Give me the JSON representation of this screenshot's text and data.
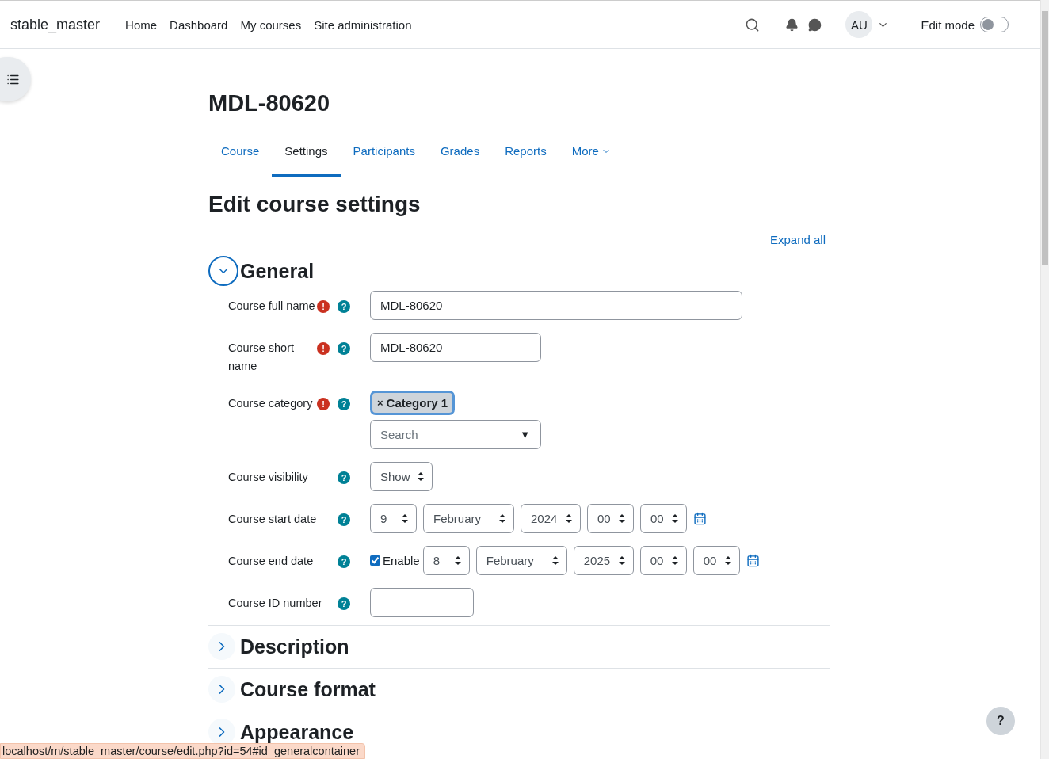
{
  "site_name": "stable_master",
  "nav": [
    "Home",
    "Dashboard",
    "My courses",
    "Site administration"
  ],
  "user_initials": "AU",
  "edit_mode": {
    "label": "Edit mode",
    "on": false
  },
  "course_title": "MDL-80620",
  "tabs": [
    {
      "label": "Course",
      "selected": false,
      "kind": "link"
    },
    {
      "label": "Settings",
      "selected": true,
      "kind": "link"
    },
    {
      "label": "Participants",
      "selected": false,
      "kind": "link"
    },
    {
      "label": "Grades",
      "selected": false,
      "kind": "link"
    },
    {
      "label": "Reports",
      "selected": false,
      "kind": "link"
    },
    {
      "label": "More",
      "selected": false,
      "kind": "dropdown"
    }
  ],
  "page_title": "Edit course settings",
  "expand_all": "Expand all",
  "sections": [
    {
      "title": "General",
      "expanded": true,
      "fields": [
        {
          "kind": "text",
          "label": "Course full name",
          "required": true,
          "value": "MDL-80620"
        },
        {
          "kind": "text",
          "label": "Course short name",
          "required": true,
          "value": "MDL-80620"
        },
        {
          "kind": "autocomplete",
          "label": "Course category",
          "required": true,
          "chips": [
            {
              "remove": "×",
              "label": "Category 1"
            }
          ],
          "placeholder": "Search",
          "arrow": "▼"
        },
        {
          "kind": "select",
          "label": "Course visibility",
          "required": false,
          "value": "Show"
        },
        {
          "kind": "date",
          "label": "Course start date",
          "required": false,
          "day": "9",
          "month": "February",
          "year": "2024",
          "hour": "00",
          "minute": "00"
        },
        {
          "kind": "date",
          "label": "Course end date",
          "required": false,
          "enable": {
            "label": "Enable",
            "checked": true
          },
          "day": "8",
          "month": "February",
          "year": "2025",
          "hour": "00",
          "minute": "00"
        },
        {
          "kind": "text",
          "label": "Course ID number",
          "required": false
        }
      ]
    },
    {
      "title": "Description",
      "expanded": false
    },
    {
      "title": "Course format",
      "expanded": false
    },
    {
      "title": "Appearance",
      "expanded": false
    }
  ],
  "status_url": "localhost/m/stable_master/course/edit.php?id=54#id_generalcontainer",
  "help_button": "?",
  "marks": {
    "required": "!",
    "help": "?"
  }
}
